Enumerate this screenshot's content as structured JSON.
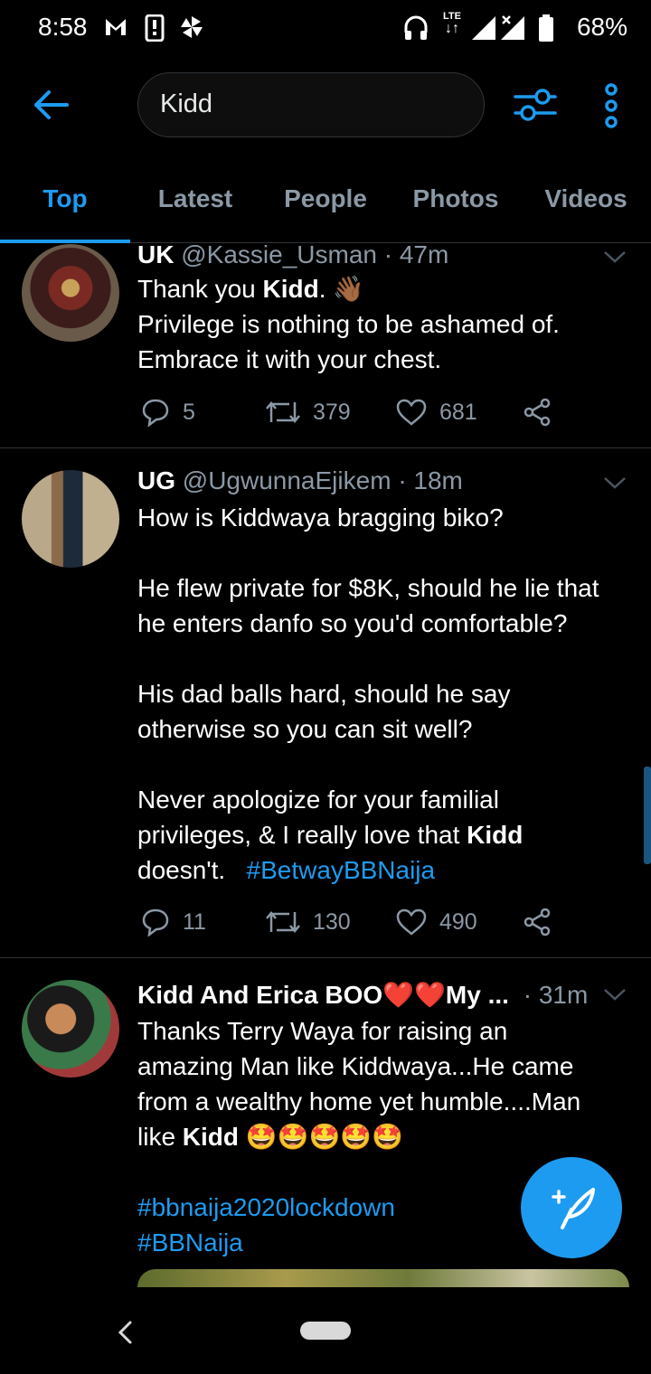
{
  "status_bar": {
    "time": "8:58",
    "battery": "68%",
    "network": "LTE"
  },
  "search": {
    "query": "Kidd"
  },
  "tabs": [
    "Top",
    "Latest",
    "People",
    "Photos",
    "Videos"
  ],
  "tweets": [
    {
      "name": "UK",
      "handle": "@Kassie_Usman",
      "time": "· 47m",
      "body_lines": [
        "Thank you ",
        "Kidd",
        ". ",
        "👋🏾",
        "Privilege is nothing to be ashamed of.",
        "Embrace it with your chest."
      ],
      "replies": "5",
      "retweets": "379",
      "likes": "681"
    },
    {
      "name": "UG",
      "handle": "@UgwunnaEjikem",
      "time": "· 18m",
      "body_lines": [
        "How is Kiddwaya bragging biko?",
        "He flew private for $8K, should he lie that",
        "he enters danfo so you'd comfortable?",
        "His dad balls hard, should he say",
        "otherwise so you can sit well?",
        "Never apologize for your familial",
        "privileges, & I really love that ",
        "Kidd",
        "doesn't.",
        "#BetwayBBNaija"
      ],
      "replies": "11",
      "retweets": "130",
      "likes": "490"
    },
    {
      "name": "Kidd And Erica BOO❤️❤️My ...",
      "handle": "",
      "time": "· 31m",
      "body_lines": [
        "Thanks Terry Waya for raising an",
        "amazing Man like Kiddwaya...He came",
        "from a wealthy home yet humble....Man",
        "like ",
        "Kidd",
        "🤩🤩🤩🤩🤩",
        "#bbnaija2020lockdown",
        "#BBNaija"
      ]
    }
  ],
  "colors": {
    "accent": "#1d9bf0",
    "muted": "#8b98a5",
    "divider": "#2f3336"
  },
  "icons": {
    "back": "arrow-left-icon",
    "filter": "sliders-icon",
    "more": "vertical-dots-icon",
    "reply": "speech-bubble-icon",
    "retweet": "retweet-icon",
    "like": "heart-icon",
    "share": "share-icon",
    "compose": "feather-plus-icon"
  }
}
